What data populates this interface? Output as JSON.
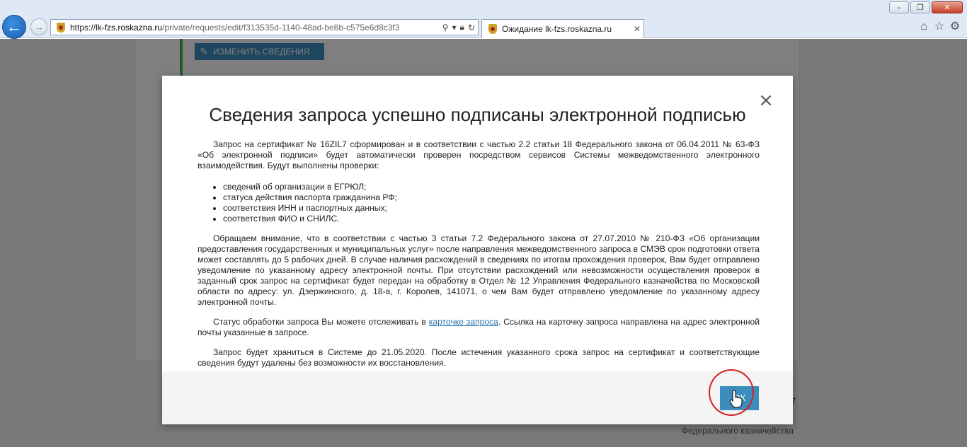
{
  "browser": {
    "url_scheme": "https://",
    "url_domain": "lk-fzs.roskazna.ru",
    "url_path": "/private/requests/edit/f313535d-1140-48ad-be8b-c575e6d8c3f3",
    "tab_title": "Ожидание lk-fzs.roskazna.ru",
    "icons": [
      "back-arrow-icon",
      "forward-arrow-icon",
      "search-icon",
      "dropdown-icon",
      "lock-icon",
      "refresh-icon",
      "home-icon",
      "star-icon",
      "gear-icon"
    ]
  },
  "page": {
    "edit_button_label": "ИЗМЕНИТЬ СВЕДЕНИЯ",
    "footer_number": "7",
    "footer_text": "Федерального казначейства"
  },
  "modal": {
    "title": "Сведения запроса успешно подписаны электронной подписью",
    "intro": "Запрос на сертификат № 16ZIL7 сформирован и в соответствии с частью 2.2 статьи 18 Федерального закона от 06.04.2011 № 63-ФЗ «Об электронной подписи» будет автоматически проверен посредством сервисов Системы межведомственного электронного взаимодействия. Будут выполнены проверки:",
    "checks": [
      "сведений об организации в ЕГРЮЛ;",
      "статуса действия паспорта гражданина РФ;",
      "соответствия ИНН и паспортных данных;",
      "соответствия ФИО и СНИЛС."
    ],
    "notice": "Обращаем внимание, что в соответствии с частью 3 статьи 7.2 Федерального закона от 27.07.2010 № 210-ФЗ «Об организации предоставления государственных и муниципальных услуг» после направления межведомственного запроса в СМЭВ срок подготовки ответа может составлять до 5 рабочих дней. В случае наличия расхождений в сведениях по итогам прохождения проверок, Вам будет отправлено уведомление по указанному адресу электронной почты. При отсутствии расхождений или невозможности осуществления проверок в заданный срок запрос на сертификат будет передан на обработку в Отдел № 12 Управления Федерального казначейства по Московской области по адресу: ул. Дзержинского, д. 18-а, г. Королев, 141071, о чем Вам будет отправлено уведомление по указанному адресу электронной почты.",
    "status_before": "Статус обработки запроса Вы можете отслеживать в ",
    "status_link": "карточке запроса",
    "status_after": ". Ссылка на карточку запроса направлена на адрес электронной почты указанные в запросе.",
    "storage": "Запрос будет храниться в Системе до 21.05.2020. После истечения указанного срока запрос на сертификат и соответствующие сведения будут удалены без возможности их восстановления.",
    "ok_label": "ОК",
    "close_glyph": "×"
  }
}
